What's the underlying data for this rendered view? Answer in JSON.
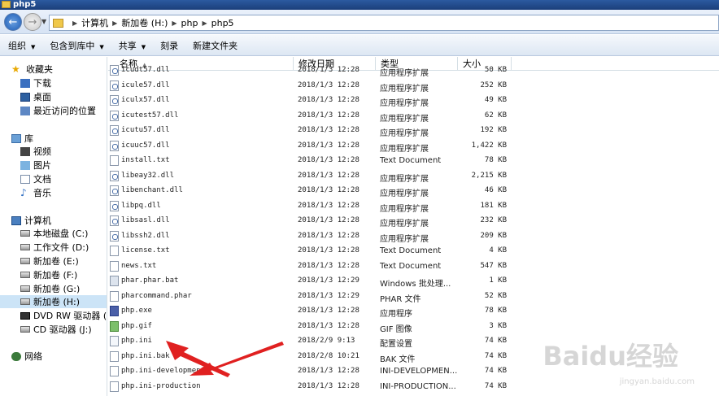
{
  "window": {
    "title": "php5"
  },
  "address": {
    "crumbs": [
      "计算机",
      "新加卷 (H:)",
      "php",
      "php5"
    ]
  },
  "toolbar": {
    "organize": "组织",
    "include_library": "包含到库中",
    "share": "共享",
    "burn": "刻录",
    "new_folder": "新建文件夹"
  },
  "nav": {
    "favorites": "收藏夹",
    "downloads": "下载",
    "desktop": "桌面",
    "recent": "最近访问的位置",
    "libraries": "库",
    "videos": "视频",
    "pictures": "图片",
    "documents": "文档",
    "music": "音乐",
    "computer": "计算机",
    "drives": [
      "本地磁盘 (C:)",
      "工作文件 (D:)",
      "新加卷 (E:)",
      "新加卷 (F:)",
      "新加卷 (G:)",
      "新加卷 (H:)",
      "DVD RW 驱动器 (I:)",
      "CD 驱动器 (J:)"
    ],
    "network": "网络"
  },
  "columns": {
    "name": "名称",
    "date": "修改日期",
    "type": "类型",
    "size": "大小"
  },
  "files": [
    {
      "name": "icudt57.dll",
      "date": "2018/1/3 12:28",
      "type": "应用程序扩展",
      "size": "50 KB",
      "kind": "dll"
    },
    {
      "name": "icule57.dll",
      "date": "2018/1/3 12:28",
      "type": "应用程序扩展",
      "size": "252 KB",
      "kind": "dll"
    },
    {
      "name": "iculx57.dll",
      "date": "2018/1/3 12:28",
      "type": "应用程序扩展",
      "size": "49 KB",
      "kind": "dll"
    },
    {
      "name": "icutest57.dll",
      "date": "2018/1/3 12:28",
      "type": "应用程序扩展",
      "size": "62 KB",
      "kind": "dll"
    },
    {
      "name": "icutu57.dll",
      "date": "2018/1/3 12:28",
      "type": "应用程序扩展",
      "size": "192 KB",
      "kind": "dll"
    },
    {
      "name": "icuuc57.dll",
      "date": "2018/1/3 12:28",
      "type": "应用程序扩展",
      "size": "1,422 KB",
      "kind": "dll"
    },
    {
      "name": "install.txt",
      "date": "2018/1/3 12:28",
      "type": "Text Document",
      "size": "78 KB",
      "kind": "txt"
    },
    {
      "name": "libeay32.dll",
      "date": "2018/1/3 12:28",
      "type": "应用程序扩展",
      "size": "2,215 KB",
      "kind": "dll"
    },
    {
      "name": "libenchant.dll",
      "date": "2018/1/3 12:28",
      "type": "应用程序扩展",
      "size": "46 KB",
      "kind": "dll"
    },
    {
      "name": "libpq.dll",
      "date": "2018/1/3 12:28",
      "type": "应用程序扩展",
      "size": "181 KB",
      "kind": "dll"
    },
    {
      "name": "libsasl.dll",
      "date": "2018/1/3 12:28",
      "type": "应用程序扩展",
      "size": "232 KB",
      "kind": "dll"
    },
    {
      "name": "libssh2.dll",
      "date": "2018/1/3 12:28",
      "type": "应用程序扩展",
      "size": "209 KB",
      "kind": "dll"
    },
    {
      "name": "license.txt",
      "date": "2018/1/3 12:28",
      "type": "Text Document",
      "size": "4 KB",
      "kind": "txt"
    },
    {
      "name": "news.txt",
      "date": "2018/1/3 12:28",
      "type": "Text Document",
      "size": "547 KB",
      "kind": "txt"
    },
    {
      "name": "phar.phar.bat",
      "date": "2018/1/3 12:29",
      "type": "Windows 批处理...",
      "size": "1 KB",
      "kind": "bat"
    },
    {
      "name": "pharcommand.phar",
      "date": "2018/1/3 12:29",
      "type": "PHAR 文件",
      "size": "52 KB",
      "kind": "txt"
    },
    {
      "name": "php.exe",
      "date": "2018/1/3 12:28",
      "type": "应用程序",
      "size": "78 KB",
      "kind": "exe"
    },
    {
      "name": "php.gif",
      "date": "2018/1/3 12:28",
      "type": "GIF 图像",
      "size": "3 KB",
      "kind": "gif"
    },
    {
      "name": "php.ini",
      "date": "2018/2/9 9:13",
      "type": "配置设置",
      "size": "74 KB",
      "kind": "ini"
    },
    {
      "name": "php.ini.bak",
      "date": "2018/2/8 10:21",
      "type": "BAK 文件",
      "size": "74 KB",
      "kind": "txt"
    },
    {
      "name": "php.ini-development",
      "date": "2018/1/3 12:28",
      "type": "INI-DEVELOPMEN...",
      "size": "74 KB",
      "kind": "txt"
    },
    {
      "name": "php.ini-production",
      "date": "2018/1/3 12:28",
      "type": "INI-PRODUCTION...",
      "size": "74 KB",
      "kind": "txt"
    }
  ],
  "watermark": {
    "logo": "Baidu经验",
    "url": "jingyan.baidu.com"
  },
  "colors": {
    "selection": "#cce4f7",
    "arrow": "#e02020",
    "titlebar": "#2c5aa0"
  }
}
